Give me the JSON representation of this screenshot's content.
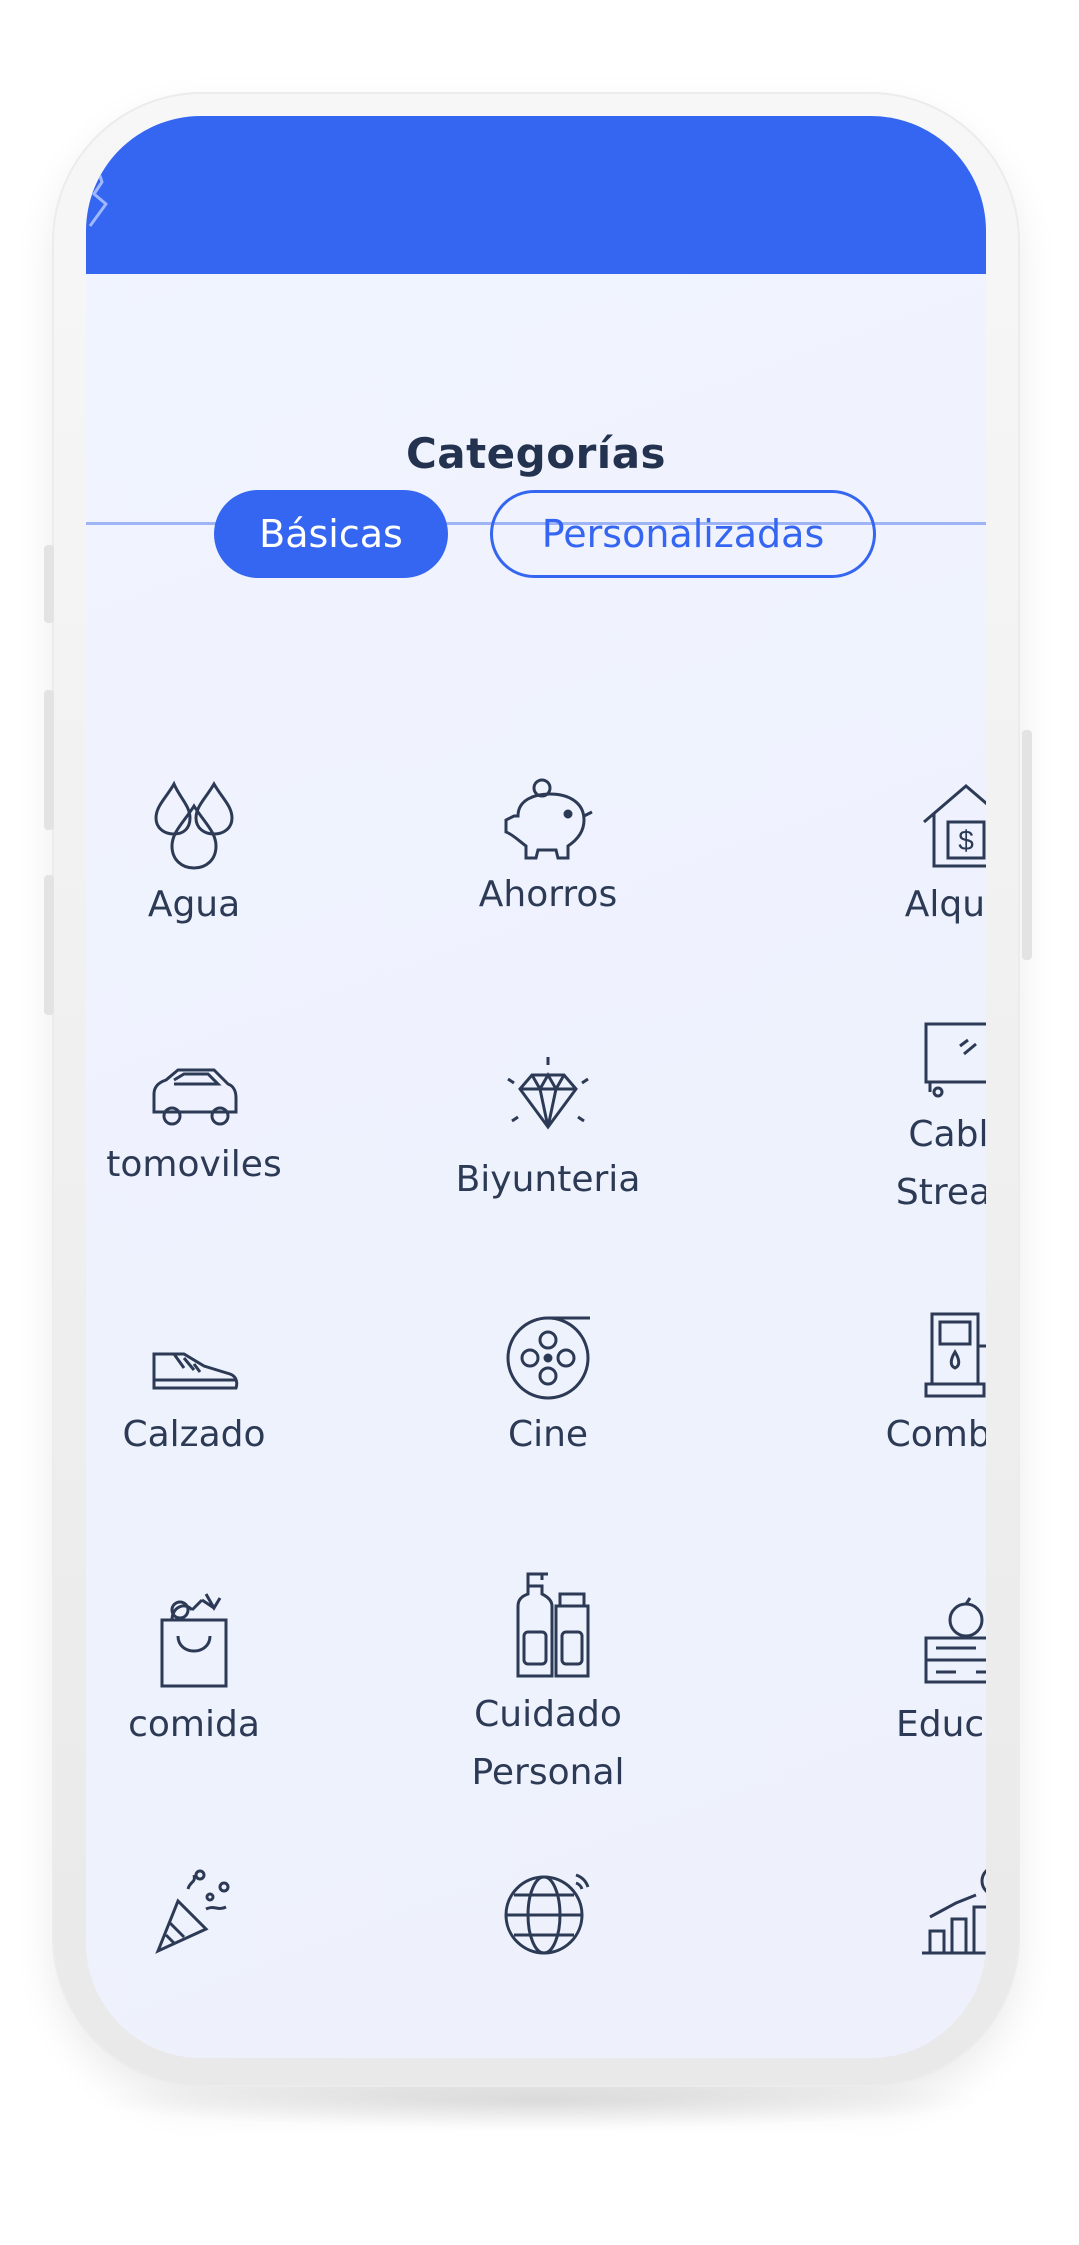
{
  "header": {
    "title": "Categorías"
  },
  "tabs": [
    {
      "label": "Básicas",
      "active": true
    },
    {
      "label": "Personalizadas",
      "active": false
    }
  ],
  "categories": [
    {
      "label": "Agua",
      "icon": "water-drops-icon"
    },
    {
      "label": "Ahorros",
      "icon": "piggy-bank-icon"
    },
    {
      "label": "Alquile",
      "icon": "house-dollar-icon"
    },
    {
      "label": "tomoviles",
      "icon": "car-icon"
    },
    {
      "label": "Biyunteria",
      "icon": "diamond-icon"
    },
    {
      "label": "Cable-\nStreami",
      "icon": "tv-icon"
    },
    {
      "label": "Calzado",
      "icon": "sneaker-icon"
    },
    {
      "label": "Cine",
      "icon": "film-reel-icon"
    },
    {
      "label": "Combust",
      "icon": "fuel-pump-icon"
    },
    {
      "label": "comida",
      "icon": "grocery-bag-icon"
    },
    {
      "label": "Cuidado\nPersonal",
      "icon": "personal-care-bottles-icon"
    },
    {
      "label": "Educaci",
      "icon": "books-apple-icon"
    },
    {
      "label": "",
      "icon": "party-popper-icon"
    },
    {
      "label": "",
      "icon": "globe-wifi-icon"
    },
    {
      "label": "",
      "icon": "growth-chart-icon"
    }
  ],
  "colors": {
    "brand": "#3566f1",
    "text": "#23324f",
    "background": "#eef2fd"
  }
}
